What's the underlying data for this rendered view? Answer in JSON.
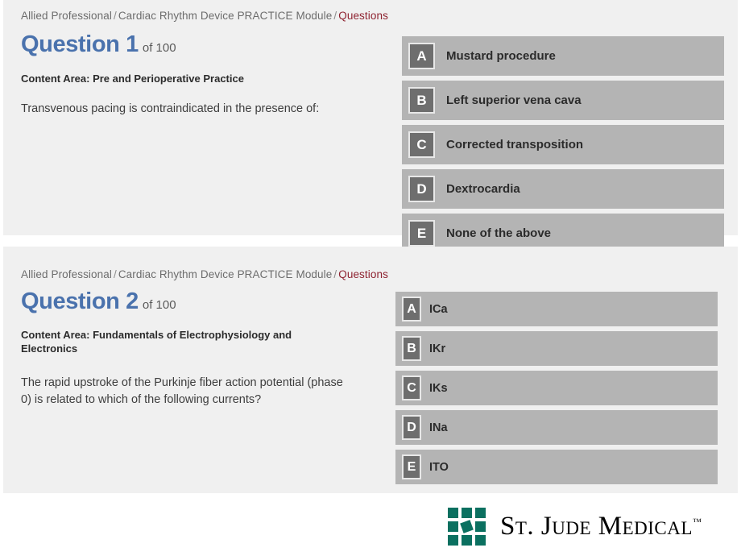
{
  "colors": {
    "panel_background": "#f0f0f0",
    "page_background": "#ffffff",
    "answer_row": "#b4b4b4",
    "answer_badge": "#6e6e6e",
    "question_heading": "#4a72ad",
    "breadcrumb_active": "#8e2230",
    "breadcrumb": "#6c6c6c",
    "logo_green": "#0b7060"
  },
  "questions": [
    {
      "breadcrumb": {
        "crumbs": [
          "Allied Professional",
          "Cardiac Rhythm Device PRACTICE Module"
        ],
        "crumb_1": "Allied Professional",
        "crumb_2": "Cardiac Rhythm Device PRACTICE Module",
        "active": "Questions",
        "separator": "/"
      },
      "title": "Question 1",
      "of_label": "of 100",
      "content_area": "Content Area: Pre and Perioperative Practice",
      "stem": "Transvenous pacing is contraindicated in the presence of:",
      "answers": [
        {
          "letter": "A",
          "text": "Mustard procedure"
        },
        {
          "letter": "B",
          "text": "Left superior vena cava"
        },
        {
          "letter": "C",
          "text": "Corrected transposition"
        },
        {
          "letter": "D",
          "text": "Dextrocardia"
        },
        {
          "letter": "E",
          "text": "None of the above"
        }
      ]
    },
    {
      "breadcrumb": {
        "crumbs": [
          "Allied Professional",
          "Cardiac Rhythm Device PRACTICE Module"
        ],
        "crumb_1": "Allied Professional",
        "crumb_2": "Cardiac Rhythm Device PRACTICE Module",
        "active": "Questions",
        "separator": "/"
      },
      "title": "Question 2",
      "of_label": "of 100",
      "content_area": "Content Area: Fundamentals of Electrophysiology and Electronics",
      "stem": "The rapid upstroke of the Purkinje fiber action potential (phase 0) is related to which of the following currents?",
      "answers": [
        {
          "letter": "A",
          "text": "ICa"
        },
        {
          "letter": "B",
          "text": "IKr"
        },
        {
          "letter": "C",
          "text": "IKs"
        },
        {
          "letter": "D",
          "text": "INa"
        },
        {
          "letter": "E",
          "text": "ITO"
        }
      ]
    }
  ],
  "footer": {
    "logo_wordmark": "St. Jude Medical",
    "logo_trademark": "™",
    "logo_mark_name": "nine-square-grid"
  }
}
